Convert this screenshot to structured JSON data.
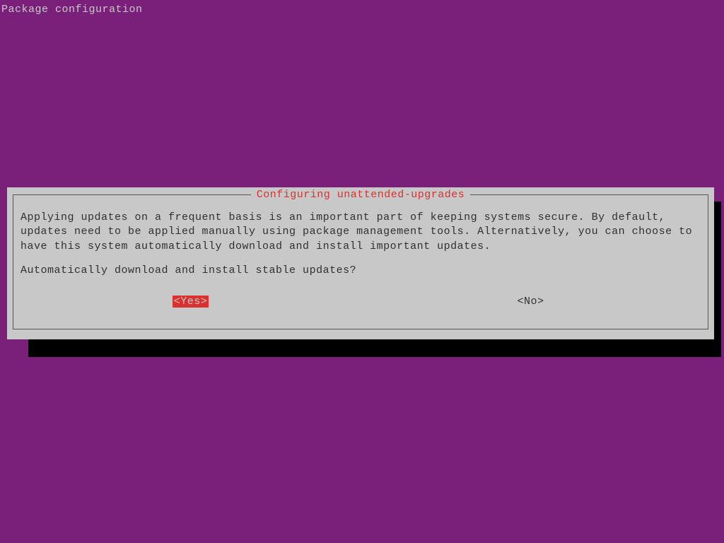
{
  "header": {
    "title": "Package configuration"
  },
  "dialog": {
    "title": "Configuring unattended-upgrades",
    "body_text": "Applying updates on a frequent basis is an important part of keeping systems secure. By default, updates need to be applied manually using package management tools. Alternatively, you can choose to have this system automatically download and install important updates.",
    "prompt": "Automatically download and install stable updates?",
    "yes_label": "<Yes>",
    "no_label": "<No>",
    "selected": "yes"
  },
  "colors": {
    "background": "#7a1f7a",
    "dialog_bg": "#c8c8c8",
    "accent": "#d93030",
    "shadow": "#000000"
  }
}
